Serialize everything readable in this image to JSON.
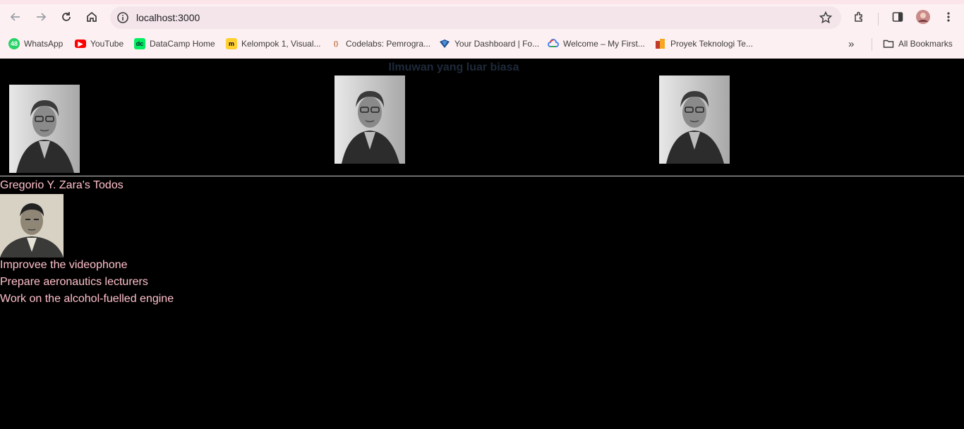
{
  "browser": {
    "url": "localhost:3000",
    "bookmarks": [
      {
        "label": "WhatsApp",
        "icon": "whatsapp-icon",
        "badge": "48",
        "color": "#25d366"
      },
      {
        "label": "YouTube",
        "icon": "youtube-icon",
        "color": "#ff0000"
      },
      {
        "label": "DataCamp Home",
        "icon": "datacamp-icon",
        "color": "#03ef62"
      },
      {
        "label": "Kelompok 1, Visual...",
        "icon": "miro-icon",
        "color": "#ffd02f"
      },
      {
        "label": "Codelabs: Pemrogra...",
        "icon": "codelabs-icon",
        "color": "#e8a060"
      },
      {
        "label": "Your Dashboard | Fo...",
        "icon": "dashboard-icon",
        "color": "#1e4d8c"
      },
      {
        "label": "Welcome – My First...",
        "icon": "google-cloud-icon",
        "color": "#4285f4"
      },
      {
        "label": "Proyek Teknologi Te...",
        "icon": "proyek-icon",
        "color": "#f5a623"
      }
    ],
    "all_bookmarks_label": "All Bookmarks"
  },
  "page": {
    "heading": "Ilmuwan yang luar biasa",
    "gallery_count": 3,
    "todo_title": "Gregorio Y. Zara's Todos",
    "todos": [
      "Improvee the videophone",
      "Prepare aeronautics lecturers",
      "Work on the alcohol-fuelled engine"
    ],
    "text_color": "#ffc0cb",
    "background": "#000000"
  }
}
